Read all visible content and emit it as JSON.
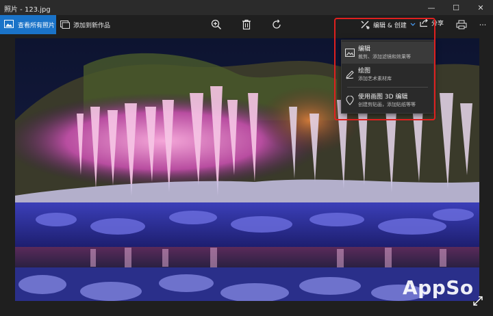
{
  "window": {
    "title": "照片 - 123.jpg",
    "min_glyph": "—",
    "max_glyph": "☐",
    "close_glyph": "✕"
  },
  "toolbar": {
    "view_all_label": "查看所有照片",
    "add_to_creation_label": "添加到新作品",
    "edit_create_label": "编辑 & 创建",
    "share_label": "分享",
    "more_label": "···"
  },
  "edit_menu": {
    "items": [
      {
        "title": "编辑",
        "subtitle": "裁剪、添加滤镜和效果等",
        "icon": "image-edit-icon"
      },
      {
        "title": "绘图",
        "subtitle": "添加艺术素材库",
        "icon": "pen-icon"
      },
      {
        "title": "使用画图 3D 编辑",
        "subtitle": "创建剪贴画，添加贴纸等等",
        "icon": "paint3d-icon"
      }
    ]
  },
  "watermark": "AppSo",
  "colors": {
    "accent": "#1a73c8",
    "highlight": "#e0201f",
    "toolbar_bg": "#1f1f1f",
    "titlebar_bg": "#2b2b2b"
  }
}
